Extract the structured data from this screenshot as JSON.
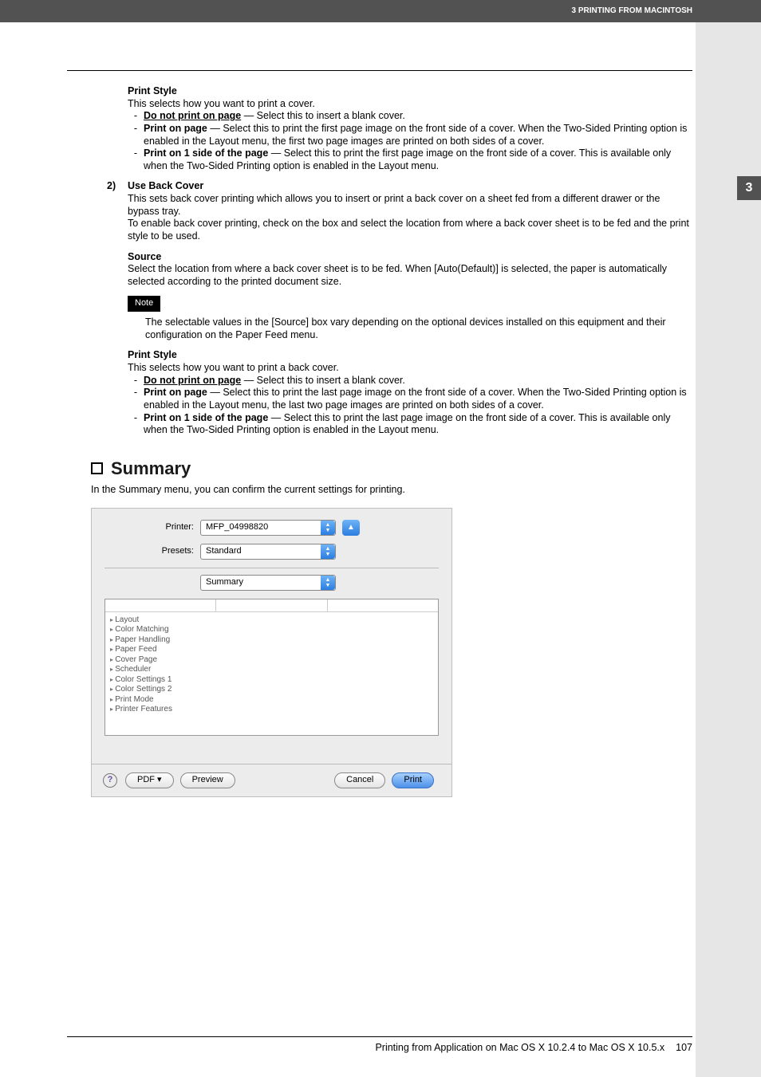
{
  "header": {
    "breadcrumb": "3 PRINTING FROM MACINTOSH",
    "chapter_tab": "3"
  },
  "ps1": {
    "heading": "Print Style",
    "intro": "This selects how you want to print a cover.",
    "b1_label": "Do not print on page",
    "b1_rest": " — Select this to insert a blank cover.",
    "b2_label": "Print on page",
    "b2_rest": " — Select this to print the first page image on the front side of a cover. When the Two-Sided Printing option is enabled in the Layout menu, the first two page images are printed on both sides of a cover.",
    "b3_label": "Print on 1 side of the page",
    "b3_rest": " — Select this to print the first page image on the front side of a cover. This is available only when the Two-Sided Printing option is enabled in the Layout menu."
  },
  "ubc": {
    "num": "2)",
    "title": "Use Back Cover",
    "p1": "This sets back cover printing which allows you to insert or print a back cover on a sheet fed from a different drawer or the bypass tray.",
    "p2": "To enable back cover printing, check on the box and select the location from where a back cover sheet is to be fed and the print style to be used.",
    "src_h": "Source",
    "src_p": "Select the location from where a back cover sheet is to be fed.  When [Auto(Default)] is selected, the paper is automatically selected according to the printed document size.",
    "note_label": "Note",
    "note_text": "The selectable values in the [Source] box vary depending on the optional devices installed on this equipment and their configuration on the Paper Feed menu."
  },
  "ps2": {
    "heading": "Print Style",
    "intro": "This selects how you want to print a back cover.",
    "b1_label": "Do not print on page",
    "b1_rest": " — Select this to insert a blank cover.",
    "b2_label": "Print on page",
    "b2_rest": " — Select this to print the last page image on the front side of a cover. When the Two-Sided Printing option is enabled in the Layout menu, the last two page images are printed on both sides of a cover.",
    "b3_label": "Print on 1 side of the page",
    "b3_rest": " — Select this to print the last page image on the front side of a cover. This is available only when the Two-Sided Printing option is enabled in the Layout menu."
  },
  "summary": {
    "title": "Summary",
    "intro": "In the Summary menu, you can confirm the current settings for printing."
  },
  "dialog": {
    "printer_label": "Printer:",
    "printer_value": "MFP_04998820",
    "presets_label": "Presets:",
    "presets_value": "Standard",
    "panel_value": "Summary",
    "list": [
      "Layout",
      "Color Matching",
      "Paper Handling",
      "Paper Feed",
      "Cover Page",
      "Scheduler",
      "Color Settings 1",
      "Color Settings 2",
      "Print Mode",
      "Printer Features"
    ],
    "help": "?",
    "pdf": "PDF ▾",
    "preview": "Preview",
    "cancel": "Cancel",
    "print": "Print",
    "status_glyph": "▲"
  },
  "footer": {
    "text": "Printing from Application on Mac OS X 10.2.4 to Mac OS X 10.5.x",
    "page": "107"
  }
}
